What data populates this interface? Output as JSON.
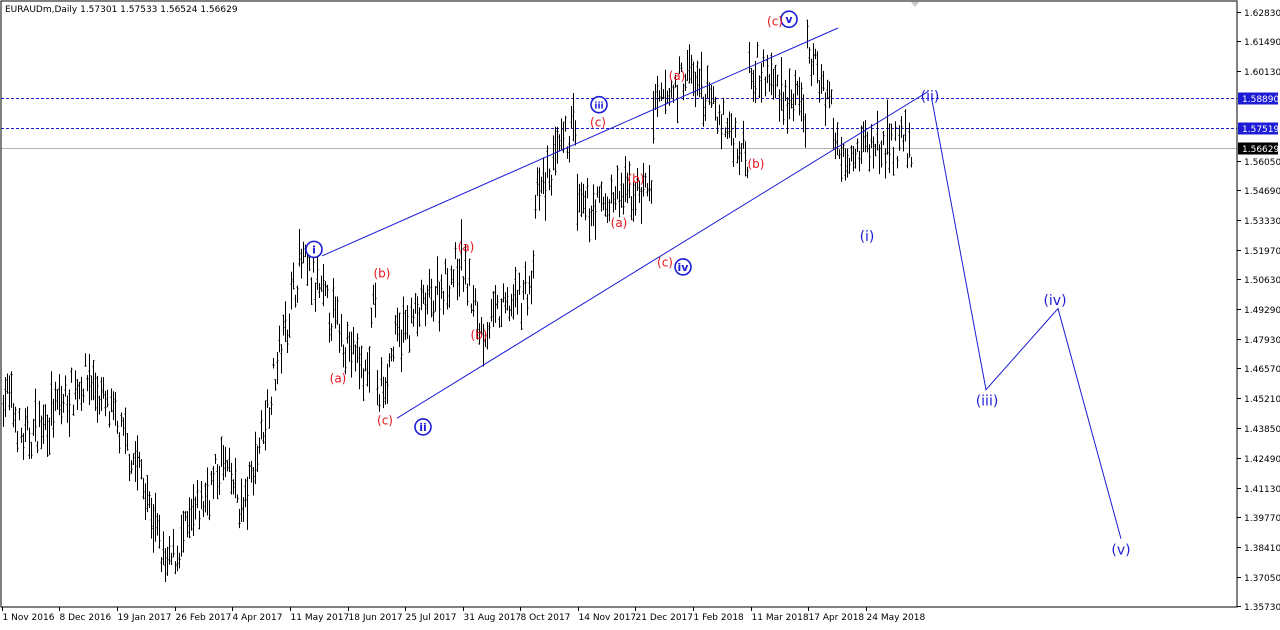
{
  "header": {
    "symbol_line": "EURAUDm,Daily  1.57301 1.57533 1.56524 1.56629"
  },
  "colors": {
    "background": "#ffffff",
    "bars": "#000000",
    "channel": "#1c1cd6",
    "wave_blue": "#1c1cd6",
    "wave_red": "#e8141e",
    "hline_dashed": "#1c1cd6",
    "current_price_line": "#b4b4b4",
    "tag_fill": "#1c1cd6",
    "tag_text": "#ffffff",
    "current_tag_fill": "#000000"
  },
  "chart_data": {
    "type": "ohlc",
    "ylim": [
      1.3573,
      1.6283
    ],
    "y_ticks": [
      "1.62830",
      "1.61490",
      "1.60130",
      "1.58890",
      "1.57519",
      "1.56629",
      "1.56050",
      "1.54690",
      "1.53330",
      "1.51970",
      "1.50630",
      "1.49290",
      "1.47930",
      "1.46570",
      "1.45210",
      "1.43850",
      "1.42490",
      "1.41130",
      "1.39770",
      "1.38410",
      "1.37050",
      "1.35730"
    ],
    "x_ticks": [
      "1 Nov 2016",
      "8 Dec 2016",
      "19 Jan 2017",
      "26 Feb 2017",
      "4 Apr 2017",
      "11 May 2017",
      "18 Jun 2017",
      "25 Jul 2017",
      "31 Aug 2017",
      "8 Oct 2017",
      "14 Nov 2017",
      "21 Dec 2017",
      "1 Feb 2018",
      "11 Mar 2018",
      "17 Apr 2018",
      "24 May 2018"
    ],
    "price_levels": [
      {
        "value": 1.5889,
        "label": "1.58890",
        "style": "dashed"
      },
      {
        "value": 1.57519,
        "label": "1.57519",
        "style": "dashed"
      },
      {
        "value": 1.56629,
        "label": "1.56629",
        "style": "current"
      }
    ],
    "price_path": [
      [
        "1 Nov 2016",
        1.455
      ],
      [
        "8 Dec 2016",
        1.432
      ],
      [
        "8 Dec 2016",
        1.462
      ],
      [
        "19 Jan 2017",
        1.418
      ],
      [
        "26 Feb 2017",
        1.373
      ],
      [
        "4 Apr 2017",
        1.423
      ],
      [
        "4 Apr 2017",
        1.4
      ],
      [
        "11 May 2017",
        1.478
      ],
      [
        "11 May 2017",
        1.515
      ],
      [
        "18 Jun 2017",
        1.462
      ],
      [
        "18 Jun 2017",
        1.502
      ],
      [
        "25 Jul 2017",
        1.443
      ],
      [
        "25 Jul 2017",
        1.478
      ],
      [
        "31 Aug 2017",
        1.514
      ],
      [
        "31 Aug 2017",
        1.483
      ],
      [
        "8 Oct 2017",
        1.505
      ],
      [
        "8 Oct 2017",
        1.528
      ],
      [
        "14 Nov 2017",
        1.578
      ],
      [
        "14 Nov 2017",
        1.532
      ],
      [
        "21 Dec 2017",
        1.549
      ],
      [
        "21 Dec 2017",
        1.518
      ],
      [
        "1 Feb 2018",
        1.571
      ],
      [
        "1 Feb 2018",
        1.601
      ],
      [
        "11 Mar 2018",
        1.562
      ],
      [
        "11 Mar 2018",
        1.619
      ],
      [
        "17 Apr 2018",
        1.582
      ],
      [
        "17 Apr 2018",
        1.612
      ],
      [
        "17 Apr 2018",
        1.588
      ],
      [
        "24 May 2018",
        1.534
      ],
      [
        "24 May 2018",
        1.567
      ]
    ],
    "forecast_path": [
      [
        "24 May 2018",
        1.588
      ],
      [
        "24 May 2018",
        1.456
      ],
      [
        "24 May 2018",
        1.493
      ],
      [
        "24 May 2018",
        1.388
      ]
    ],
    "channel_upper": [
      [
        "11 May 2017",
        1.517
      ],
      [
        "17 Apr 2018",
        1.621
      ]
    ],
    "channel_lower": [
      [
        "18 Jun 2017",
        1.443
      ],
      [
        "24 May 2018",
        1.592
      ]
    ],
    "wave_labels": [
      {
        "text": "i",
        "style": "circle",
        "color": "blue",
        "x": "11 May 2017",
        "y": 1.52
      },
      {
        "text": "ii",
        "style": "circle",
        "color": "blue",
        "x": "25 Jul 2017",
        "y": 1.439
      },
      {
        "text": "iii",
        "style": "circle",
        "color": "blue",
        "x": "14 Nov 2017",
        "y": 1.586
      },
      {
        "text": "iv",
        "style": "circle",
        "color": "blue",
        "x": "21 Dec 2017",
        "y": 1.512
      },
      {
        "text": "v",
        "style": "circle",
        "color": "blue",
        "x": "11 Mar 2018",
        "y": 1.625
      },
      {
        "text": "(a)",
        "style": "paren",
        "color": "red",
        "x": "11 May 2017",
        "y": 1.461
      },
      {
        "text": "(b)",
        "style": "paren",
        "color": "red",
        "x": "18 Jun 2017",
        "y": 1.509
      },
      {
        "text": "(c)",
        "style": "paren",
        "color": "red",
        "x": "18 Jun 2017",
        "y": 1.442
      },
      {
        "text": "(a)",
        "style": "paren",
        "color": "red",
        "x": "31 Aug 2017",
        "y": 1.521
      },
      {
        "text": "(b)",
        "style": "paren",
        "color": "red",
        "x": "31 Aug 2017",
        "y": 1.481
      },
      {
        "text": "(c)",
        "style": "paren",
        "color": "red",
        "x": "14 Nov 2017",
        "y": 1.578
      },
      {
        "text": "(b)",
        "style": "paren",
        "color": "red",
        "x": "14 Nov 2017",
        "y": 1.552
      },
      {
        "text": "(a)",
        "style": "paren",
        "color": "red",
        "x": "14 Nov 2017",
        "y": 1.532
      },
      {
        "text": "(c)",
        "style": "paren",
        "color": "red",
        "x": "21 Dec 2017",
        "y": 1.514
      },
      {
        "text": "(a)",
        "style": "paren",
        "color": "red",
        "x": "1 Feb 2018",
        "y": 1.599
      },
      {
        "text": "(b)",
        "style": "paren",
        "color": "red",
        "x": "11 Mar 2018",
        "y": 1.559
      },
      {
        "text": "(c)",
        "style": "paren",
        "color": "red",
        "x": "11 Mar 2018",
        "y": 1.624
      },
      {
        "text": "(i)",
        "style": "paren",
        "color": "blue",
        "x": "24 May 2018",
        "y": 1.526
      },
      {
        "text": "(ii)",
        "style": "paren",
        "color": "blue",
        "x": "24 May 2018",
        "y": 1.59
      },
      {
        "text": "(iii)",
        "style": "paren",
        "color": "blue",
        "x": "24 May 2018",
        "y": 1.451
      },
      {
        "text": "(iv)",
        "style": "paren",
        "color": "blue",
        "x": "24 May 2018",
        "y": 1.497
      },
      {
        "text": "(v)",
        "style": "paren",
        "color": "blue",
        "x": "24 May 2018",
        "y": 1.383
      }
    ]
  }
}
